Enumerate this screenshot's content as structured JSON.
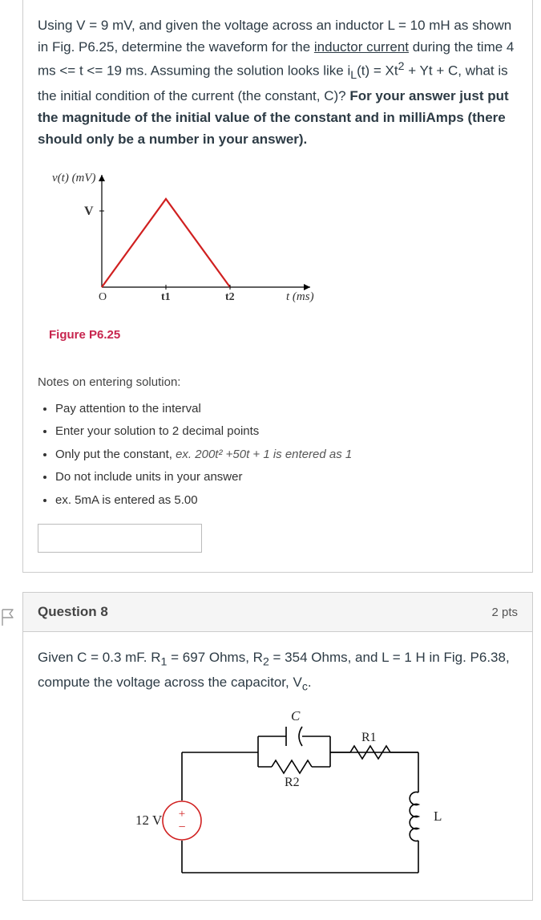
{
  "q7": {
    "text_pre": "Using V = 9 mV, and given the voltage across an inductor L = 10 mH as shown in Fig. P6.25, determine the waveform for the ",
    "underline": "inductor current",
    "text_mid": " during the time 4 ms <= t <= 19 ms. Assuming the solution looks like i",
    "sub1": "L",
    "text_mid2": "(t) = Xt",
    "sup1": "2",
    "text_mid3": " + Yt + C, what is the initial condition of the current (the constant, C)?  ",
    "bold": "For your answer just put the magnitude of the initial value of the constant and in milliAmps (there should only be a number in your answer).",
    "fig": {
      "ylabel": "v(t) (mV)",
      "V": "V",
      "O": "O",
      "t1": "t1",
      "t2": "t2",
      "xlabel": "t (ms)",
      "caption": "Figure P6.25"
    },
    "notes_title": "Notes on entering solution:",
    "notes": {
      "n1": "Pay attention to the interval",
      "n2": "Enter your solution to 2 decimal points",
      "n3_pre": "Only put the constant, ",
      "n3_it": "ex. 200t² +50t + 1 is entered as 1",
      "n4": "Do not include units in your answer",
      "n5": "ex. 5mA is entered as 5.00"
    }
  },
  "q8": {
    "title": "Question 8",
    "pts": "2 pts",
    "text_pre": "Given C = 0.3 mF. R",
    "sub1": "1",
    "text_mid1": " = 697 Ohms, R",
    "sub2": "2",
    "text_mid2": " = 354 Ohms, and L = 1 H in Fig. P6.38, compute the voltage across the capacitor, V",
    "sub3": "c",
    "text_end": ".",
    "circ": {
      "vsrc": "12 V",
      "C": "C",
      "R1": "R1",
      "R2": "R2",
      "L": "L"
    }
  },
  "chart_data": {
    "type": "line",
    "title": "v(t) (mV) vs t (ms)",
    "xlabel": "t (ms)",
    "ylabel": "v(t) (mV)",
    "series": [
      {
        "name": "v(t)",
        "points": [
          {
            "x": "O",
            "y": 0
          },
          {
            "x": "t1",
            "y": "V"
          },
          {
            "x": "t2",
            "y": 0
          }
        ]
      }
    ],
    "annotations": [
      "V marked on y-axis",
      "O at origin",
      "t1 and t2 marked on x-axis",
      "triangular waveform in red"
    ]
  }
}
